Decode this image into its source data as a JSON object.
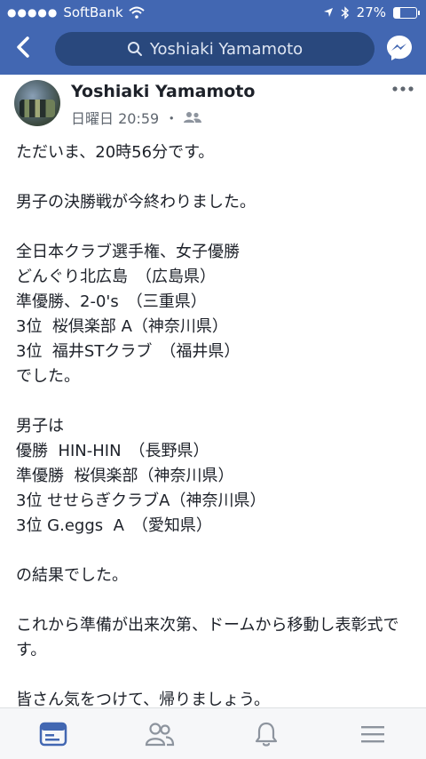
{
  "status_bar": {
    "carrier": "SoftBank",
    "battery_percent": "27%",
    "battery_level": 0.27
  },
  "topbar": {
    "search_text": "Yoshiaki Yamamoto",
    "icons": [
      "back-arrow-icon",
      "search-icon",
      "messenger-icon"
    ],
    "accent_color": "#4267b2"
  },
  "post": {
    "author": "Yoshiaki Yamamoto",
    "timestamp": "日曜日 20:59",
    "separator": "・",
    "audience_icon": "friends-icon",
    "body": "ただいま、20時56分です。\n\n男子の決勝戦が今終わりました。\n\n全日本クラブ選手権、女子優勝\nどんぐり北広島　（広島県）\n準優勝、2-0's　（三重県）\n3位  桜倶楽部 A（神奈川県）\n3位  福井STクラブ　（福井県）\nでした。\n\n男子は\n優勝  HIN-HIN　（長野県）\n準優勝  桜倶楽部（神奈川県）\n3位 せせらぎクラブA（神奈川県）\n3位 G.eggs  A　（愛知県）\n\nの結果でした。\n\nこれから準備が出来次第、ドームから移動し表彰式です。\n\n皆さん気をつけて、帰りましょう。"
  },
  "tabbar": {
    "tabs": [
      {
        "icon": "news-feed-icon",
        "active": true
      },
      {
        "icon": "friends-icon",
        "active": false
      },
      {
        "icon": "notifications-bell-icon",
        "active": false
      },
      {
        "icon": "menu-icon",
        "active": false
      }
    ],
    "active_color": "#4267b2",
    "inactive_color": "#8d949e"
  }
}
